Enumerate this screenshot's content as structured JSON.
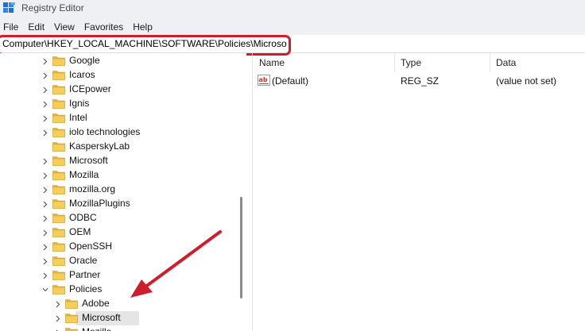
{
  "window": {
    "title": "Registry Editor"
  },
  "menu": {
    "items": [
      "File",
      "Edit",
      "View",
      "Favorites",
      "Help"
    ]
  },
  "address": {
    "value": "Computer\\HKEY_LOCAL_MACHINE\\SOFTWARE\\Policies\\Microsoft"
  },
  "tree": {
    "items": [
      {
        "label": "Google",
        "expandable": true
      },
      {
        "label": "Icaros",
        "expandable": true
      },
      {
        "label": "ICEpower",
        "expandable": true
      },
      {
        "label": "Ignis",
        "expandable": true
      },
      {
        "label": "Intel",
        "expandable": true
      },
      {
        "label": "iolo technologies",
        "expandable": true
      },
      {
        "label": "KasperskyLab",
        "expandable": false
      },
      {
        "label": "Microsoft",
        "expandable": true
      },
      {
        "label": "Mozilla",
        "expandable": true
      },
      {
        "label": "mozilla.org",
        "expandable": true
      },
      {
        "label": "MozillaPlugins",
        "expandable": true
      },
      {
        "label": "ODBC",
        "expandable": true
      },
      {
        "label": "OEM",
        "expandable": true
      },
      {
        "label": "OpenSSH",
        "expandable": true
      },
      {
        "label": "Oracle",
        "expandable": true
      },
      {
        "label": "Partner",
        "expandable": true
      },
      {
        "label": "Policies",
        "expandable": true,
        "expanded": true
      },
      {
        "label": "Adobe",
        "expandable": true,
        "child": true
      },
      {
        "label": "Microsoft",
        "expandable": true,
        "child": true,
        "selected": true
      },
      {
        "label": "Mozilla",
        "expandable": true,
        "child": true
      }
    ]
  },
  "list": {
    "columns": {
      "name": "Name",
      "type": "Type",
      "data": "Data"
    },
    "rows": [
      {
        "name": "(Default)",
        "type": "REG_SZ",
        "data": "(value not set)"
      }
    ]
  },
  "colors": {
    "highlight_red": "#cf1d2c",
    "folder_yellow": "#f2c94c",
    "selection_gray": "#e5e5e5",
    "ab_icon_red": "#c0392b"
  },
  "icons": [
    "registry-app-icon",
    "folder-icon",
    "chevron-right-icon",
    "chevron-down-icon",
    "string-value-icon",
    "annotation-arrow"
  ]
}
